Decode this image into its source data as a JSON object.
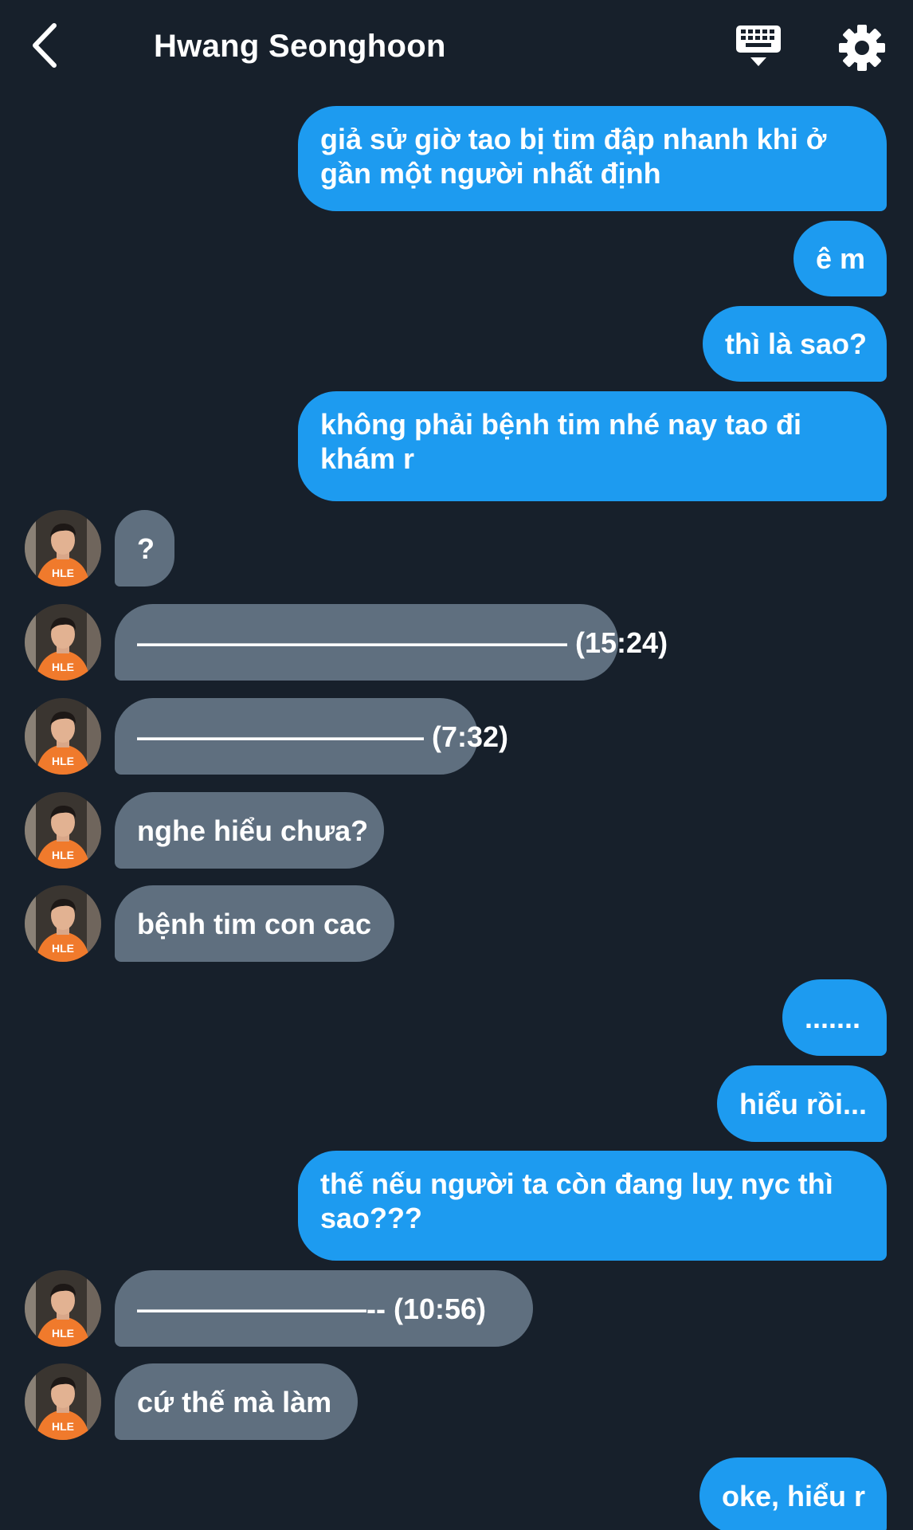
{
  "header": {
    "title": "Hwang Seonghoon",
    "back_icon": "chevron-left-icon",
    "keyboard_icon": "keyboard-icon",
    "settings_icon": "gear-icon"
  },
  "colors": {
    "background": "#17202b",
    "outgoing_bubble": "#1d9bf0",
    "incoming_bubble": "#5f6f7f"
  },
  "avatar": {
    "shirt_text": "HLE"
  },
  "messages": [
    {
      "side": "out",
      "text": "giả sử giờ tao bị tim đập nhanh khi ở gần một người nhất định"
    },
    {
      "side": "out",
      "text": "ê m"
    },
    {
      "side": "out",
      "text": "thì là sao?"
    },
    {
      "side": "out",
      "text": "không phải bệnh tim nhé nay tao đi khám r"
    },
    {
      "side": "in",
      "text": "?"
    },
    {
      "side": "in",
      "text": "——————————————— (15:24)"
    },
    {
      "side": "in",
      "text": "—————————— (7:32)"
    },
    {
      "side": "in",
      "text": "nghe hiểu chưa?"
    },
    {
      "side": "in",
      "text": "bệnh tim con cac"
    },
    {
      "side": "out",
      "text": "......."
    },
    {
      "side": "out",
      "text": "hiểu rồi..."
    },
    {
      "side": "out",
      "text": "thế nếu người ta còn đang luỵ nyc thì sao???"
    },
    {
      "side": "in",
      "text": "————————-- (10:56)"
    },
    {
      "side": "in",
      "text": "cứ thế mà làm"
    },
    {
      "side": "out",
      "text": "oke, hiểu r"
    }
  ]
}
